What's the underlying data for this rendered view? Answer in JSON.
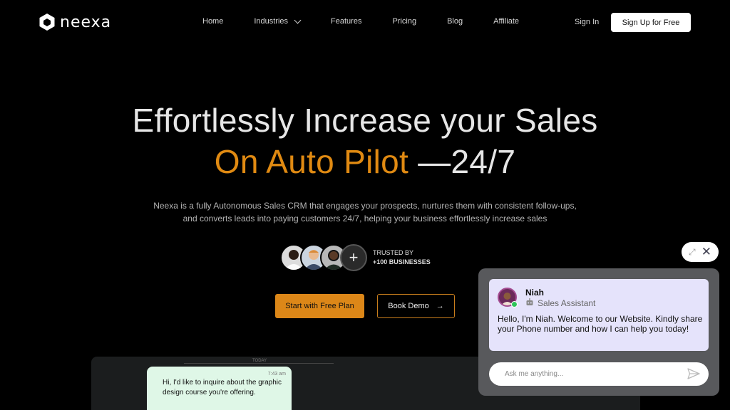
{
  "nav": {
    "brand": "neexa",
    "links": [
      "Home",
      "Industries",
      "Features",
      "Pricing",
      "Blog",
      "Affiliate"
    ],
    "signin": "Sign In",
    "signup": "Sign Up for Free"
  },
  "hero": {
    "line1": "Effortlessly Increase your Sales",
    "line2_accent": "On Auto Pilot",
    "line2_rest": " —24/7",
    "desc1": "Neexa is a fully Autonomous Sales CRM that engages your prospects, nurtures them with consistent follow-ups,",
    "desc2": "and converts leads into paying customers 24/7, helping your business effortlessly increase sales",
    "trusted_by": "TRUSTED BY",
    "trusted_count": "+100 BUSINESSES",
    "plus": "+",
    "cta_primary": "Start with Free Plan",
    "cta_secondary": "Book Demo",
    "cta_secondary_arrow": "→"
  },
  "demo": {
    "day_label": "TODAY",
    "message_time": "7:43 am",
    "message": "Hi, I'd like to inquire about the graphic design course you're offering."
  },
  "chat": {
    "agent_name": "Niah",
    "agent_role": "Sales Assistant",
    "greeting": "Hello, I'm Niah. Welcome to our Website. Kindly share your Phone number and how I can help you today!",
    "input_placeholder": "Ask me anything..."
  },
  "colors": {
    "accent": "#e08a12",
    "background": "#000000",
    "chat_card": "#e5e3fb"
  }
}
